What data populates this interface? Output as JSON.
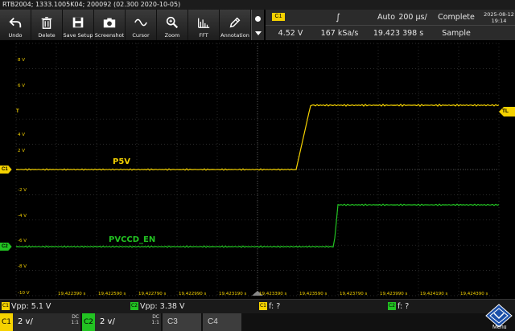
{
  "titlebar": {
    "text": "RTB2004; 1333.1005K04; 200092 (02.300 2020-10-05)"
  },
  "toolbar": {
    "items": [
      {
        "label": "Undo",
        "icon": "undo-icon"
      },
      {
        "label": "Delete",
        "icon": "trash-icon"
      },
      {
        "label": "Save Setup",
        "icon": "save-icon"
      },
      {
        "label": "Screenshot",
        "icon": "camera-icon"
      },
      {
        "label": "Cursor",
        "icon": "cursor-wave-icon"
      },
      {
        "label": "Zoom",
        "icon": "zoom-icon"
      },
      {
        "label": "FFT",
        "icon": "fft-icon"
      },
      {
        "label": "Annotation",
        "icon": "pen-icon"
      }
    ]
  },
  "info": {
    "channel": "C1",
    "trigger_level": "4.52 V",
    "trigger_slope_symbol": "∫",
    "sample_rate": "167 kSa/s",
    "trigger_mode": "Auto",
    "time_position": "19.423 398 s",
    "timebase": "200 µs/",
    "acq_status": "Complete",
    "acq_mode": "Sample",
    "date": "2025-08-12",
    "time": "19:14"
  },
  "grid": {
    "y_labels": [
      "8 V",
      "6 V",
      "4 V",
      "2 V",
      "-2 V",
      "-4 V",
      "-6 V",
      "-8 V",
      "-10 V"
    ],
    "time_labels": [
      "19,422390 s",
      "19,422590 s",
      "19,422790 s",
      "19,422990 s",
      "19,423190 s",
      "19,423390 s",
      "19,423590 s",
      "19,423790 s",
      "19,423990 s",
      "19,424190 s",
      "19,424390 s"
    ]
  },
  "markers": {
    "trigger_level": "T",
    "trigger_time": "TL",
    "ch1_ref": "C1",
    "ch2_ref": "C2"
  },
  "traces": {
    "ch1_label": "P5V",
    "ch2_label": "PVCCD_EN"
  },
  "measurements": [
    {
      "channel": "C1",
      "text": "Vpp: 5.1 V"
    },
    {
      "channel": "C2",
      "text": "Vpp: 3.38 V"
    },
    {
      "channel": "C1",
      "text": "f: ?"
    },
    {
      "channel": "C2",
      "text": "f: ?"
    }
  ],
  "channels": [
    {
      "name": "C1",
      "scale": "2 v/",
      "coupling": "DC",
      "bw": "1:1",
      "active": true
    },
    {
      "name": "C2",
      "scale": "2 v/",
      "coupling": "DC",
      "bw": "1:1",
      "active": true
    },
    {
      "name": "C3",
      "active": false
    },
    {
      "name": "C4",
      "active": false
    }
  ],
  "menu": {
    "label": "Menu"
  },
  "colors": {
    "ch1": "#f5d200",
    "ch2": "#22c322",
    "grid": "#3a3a3a",
    "brand": "#1b4fa8"
  }
}
